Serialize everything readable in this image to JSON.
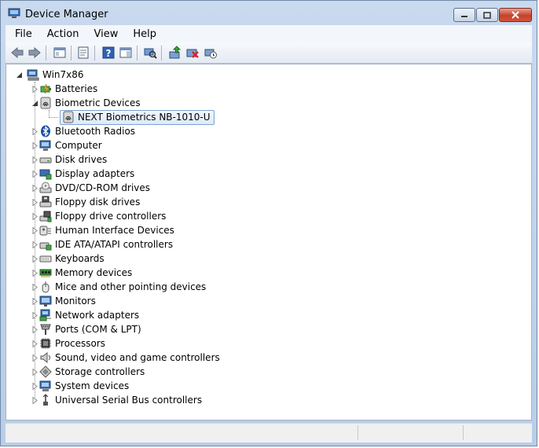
{
  "window": {
    "title": "Device Manager"
  },
  "menubar": {
    "items": [
      "File",
      "Action",
      "View",
      "Help"
    ]
  },
  "toolbar": {
    "buttons": [
      "back-icon",
      "forward-icon",
      "show-hide-tree-icon",
      "properties-icon",
      "help-icon",
      "action-pane-icon",
      "scan-hardware-icon",
      "update-driver-icon",
      "uninstall-icon",
      "disable-icon"
    ]
  },
  "tree": {
    "root": "Win7x86",
    "categories": [
      {
        "label": "Batteries",
        "icon": "battery-icon"
      },
      {
        "label": "Biometric Devices",
        "icon": "fingerprint-icon",
        "expanded": true
      },
      {
        "label": "Bluetooth Radios",
        "icon": "bluetooth-icon"
      },
      {
        "label": "Computer",
        "icon": "computer-icon"
      },
      {
        "label": "Disk drives",
        "icon": "disk-drive-icon"
      },
      {
        "label": "Display adapters",
        "icon": "display-adapter-icon"
      },
      {
        "label": "DVD/CD-ROM drives",
        "icon": "dvd-drive-icon"
      },
      {
        "label": "Floppy disk drives",
        "icon": "floppy-disk-icon"
      },
      {
        "label": "Floppy drive controllers",
        "icon": "floppy-controller-icon"
      },
      {
        "label": "Human Interface Devices",
        "icon": "hid-icon"
      },
      {
        "label": "IDE ATA/ATAPI controllers",
        "icon": "ide-controller-icon"
      },
      {
        "label": "Keyboards",
        "icon": "keyboard-icon"
      },
      {
        "label": "Memory devices",
        "icon": "memory-icon"
      },
      {
        "label": "Mice and other pointing devices",
        "icon": "mouse-icon"
      },
      {
        "label": "Monitors",
        "icon": "monitor-icon"
      },
      {
        "label": "Network adapters",
        "icon": "network-adapter-icon"
      },
      {
        "label": "Ports (COM & LPT)",
        "icon": "port-icon"
      },
      {
        "label": "Processors",
        "icon": "processor-icon"
      },
      {
        "label": "Sound, video and game controllers",
        "icon": "sound-icon"
      },
      {
        "label": "Storage controllers",
        "icon": "storage-controller-icon"
      },
      {
        "label": "System devices",
        "icon": "system-devices-icon"
      },
      {
        "label": "Universal Serial Bus controllers",
        "icon": "usb-icon"
      }
    ],
    "selected_device": {
      "label": "NEXT Biometrics NB-1010-U",
      "icon": "fingerprint-icon"
    }
  },
  "colors": {
    "selection_border": "#7da2ce",
    "title_bar": "#c9d9ee",
    "close_button": "#c4422c"
  }
}
